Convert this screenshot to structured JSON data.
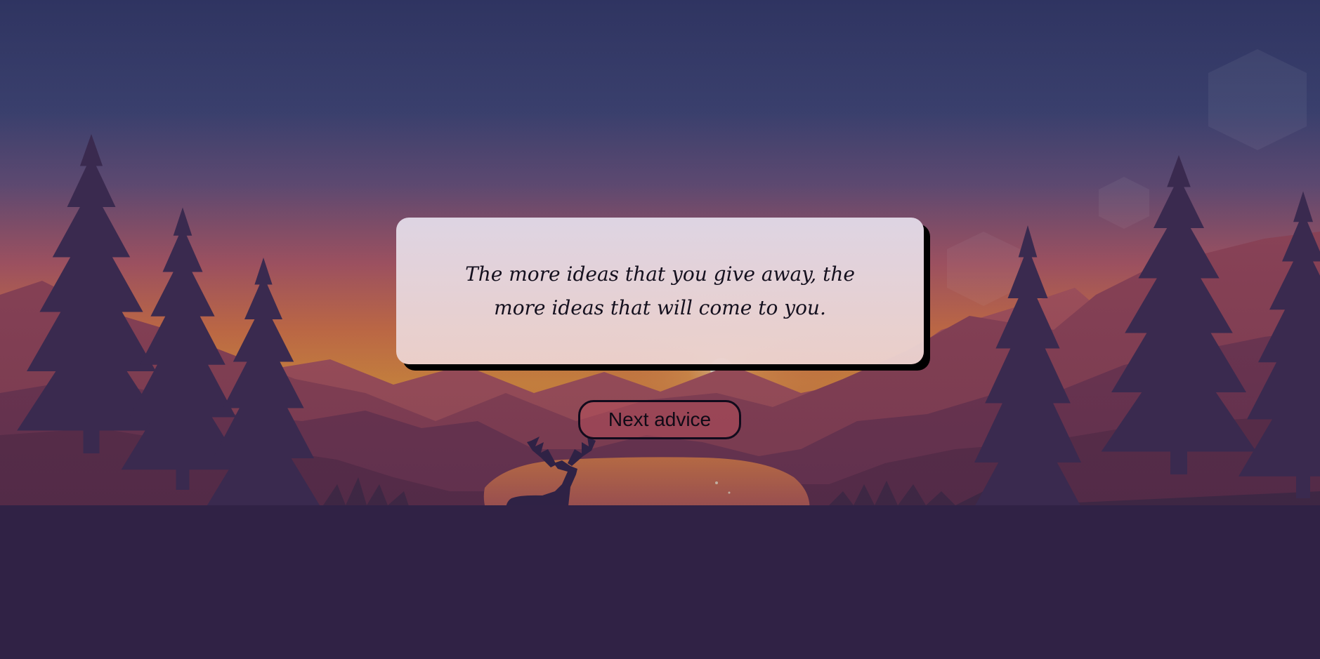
{
  "advice": {
    "quote": "The more ideas that you give away, the more ideas that will come to you."
  },
  "controls": {
    "next_label": "Next advice"
  },
  "background": {
    "icon": "forest-sunset-deer-illustration",
    "sky_top": "#2f3563",
    "sky_horizon": "#e8843e",
    "mountain_color": "#6a3554",
    "foreground_color": "#2e2443",
    "lake_color": "#c36a5a"
  }
}
